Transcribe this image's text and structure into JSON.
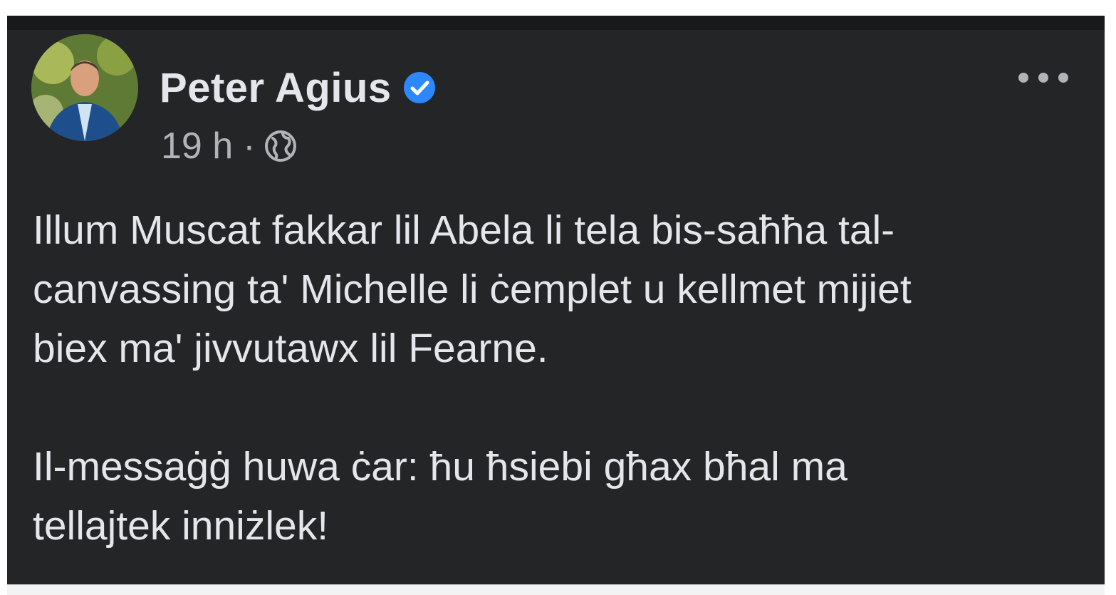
{
  "post": {
    "author_name": "Peter Agius",
    "timestamp": "19 h",
    "separator": "·",
    "privacy_icon": "globe-icon",
    "verified_icon": "verified-badge-icon",
    "more_icon": "more-options-icon",
    "paragraph_1": [
      "Illum Muscat fakkar lil Abela li tela bis-saħħa tal-",
      "canvassing ta' Michelle li ċemplet u kellmet mijiet",
      "biex ma' jivvutawx lil Fearne."
    ],
    "paragraph_2": [
      "Il-messaġġ huwa ċar: ħu ħsiebi għax bħal ma",
      "tellajtek inniżlek!"
    ]
  },
  "colors": {
    "background": "#242526",
    "text_primary": "#e4e6eb",
    "text_secondary": "#b0b3b8",
    "verified_blue": "#2d88ff"
  }
}
